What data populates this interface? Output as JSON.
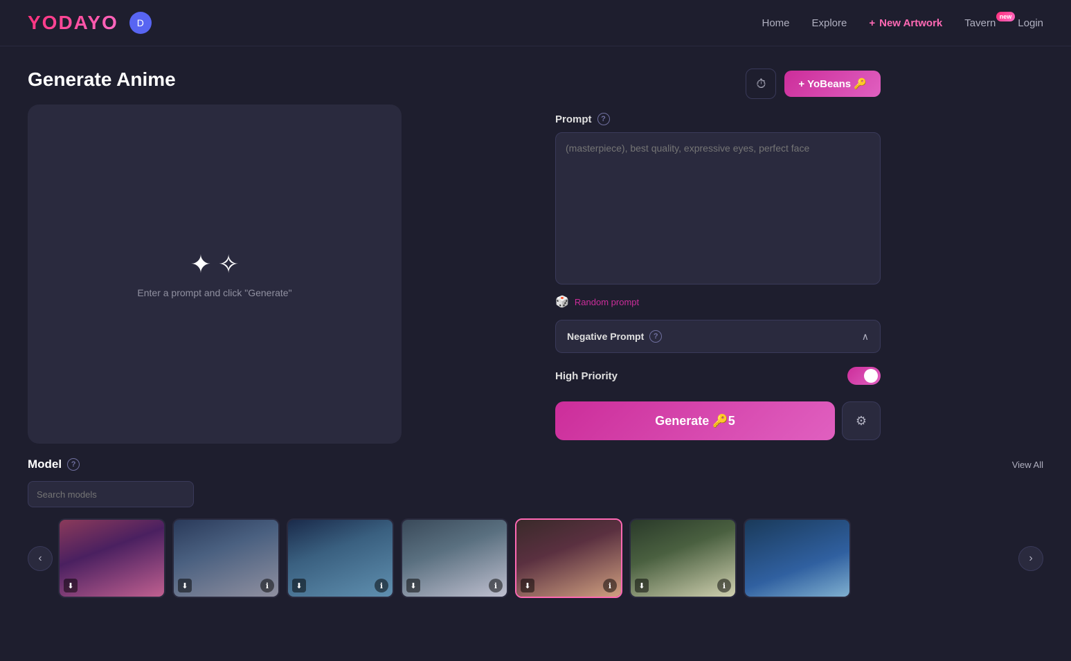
{
  "header": {
    "logo": "YODAYO",
    "nav": {
      "home": "Home",
      "explore": "Explore",
      "new_artwork_prefix": "+",
      "new_artwork": "New Artwork",
      "tavern": "Tavern",
      "tavern_badge": "new",
      "login": "Login"
    }
  },
  "toolbar": {
    "history_icon": "⏱",
    "yobeans_icon": "🔑",
    "yobeans_label": "+ YoBeans 🔑"
  },
  "page": {
    "title": "Generate Anime"
  },
  "canvas": {
    "hint": "Enter a prompt and click \"Generate\""
  },
  "prompt": {
    "label": "Prompt",
    "placeholder": "(masterpiece), best quality, expressive eyes, perfect face",
    "random_label": "Random prompt"
  },
  "negative_prompt": {
    "label": "Negative Prompt"
  },
  "high_priority": {
    "label": "High Priority"
  },
  "generate": {
    "label": "Generate 🔑5",
    "settings_icon": "⚙"
  },
  "model": {
    "label": "Model",
    "search_placeholder": "Search models",
    "view_all": "View All"
  },
  "icons": {
    "help": "?",
    "chevron_up": "∧",
    "left_arrow": "‹",
    "right_arrow": "›",
    "info": "ℹ",
    "download": "⬇",
    "dice": "🎲",
    "discord": "D"
  }
}
